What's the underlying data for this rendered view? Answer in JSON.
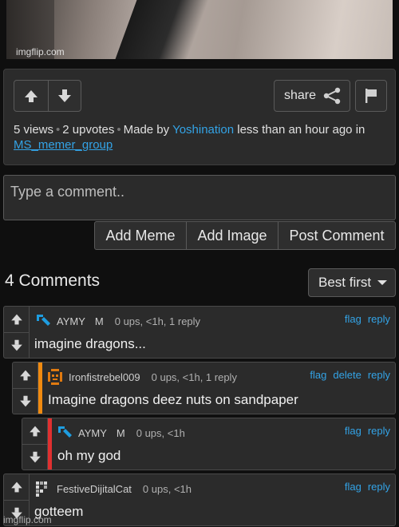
{
  "image": {
    "watermark": "imgflip.com"
  },
  "post": {
    "share_label": "share",
    "views": "5 views",
    "upvotes": "2 upvotes",
    "made_by": "Made by",
    "author": "Yoshination",
    "time": "less than an hour ago in",
    "group": "MS_memer_group"
  },
  "compose": {
    "placeholder": "Type a comment..",
    "buttons": [
      "Add Meme",
      "Add Image",
      "Post Comment"
    ]
  },
  "comments_header": {
    "count": "4 Comments",
    "sort": "Best first"
  },
  "comments": [
    {
      "user": "AYMY",
      "badge": "M",
      "meta": "0 ups, <1h, 1 reply",
      "actions": [
        "flag",
        "reply"
      ],
      "text": "imagine dragons...",
      "accent": ""
    },
    {
      "user": "Ironfistrebel009",
      "badge": "",
      "meta": "0 ups, <1h, 1 reply",
      "actions": [
        "flag",
        "delete",
        "reply"
      ],
      "text": "Imagine dragons deez nuts on sandpaper",
      "accent": "#f08a10"
    },
    {
      "user": "AYMY",
      "badge": "M",
      "meta": "0 ups, <1h",
      "actions": [
        "flag",
        "reply"
      ],
      "text": "oh my god",
      "accent": "#e03030"
    },
    {
      "user": "FestiveDijitalCat",
      "badge": "",
      "meta": "0 ups, <1h",
      "actions": [
        "flag",
        "reply"
      ],
      "text": "gotteem",
      "accent": ""
    }
  ],
  "footer": {
    "watermark": "imgflip.com"
  },
  "colors": {
    "link": "#33a3e6",
    "background": "#0f0f0f",
    "panel": "#2b2b2b"
  }
}
